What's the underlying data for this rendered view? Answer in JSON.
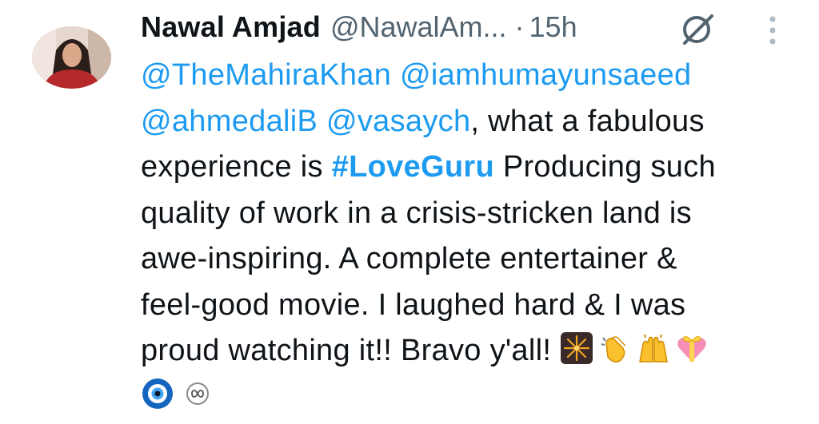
{
  "tweet": {
    "author_name": "Nawal Amjad",
    "author_handle": "@NawalAm...",
    "separator": "·",
    "timestamp": "15h",
    "icons": {
      "grok": "grok-slash-icon",
      "more": "more-vertical-icon"
    },
    "body": {
      "line1": {
        "mention1": "@TheMahiraKhan",
        "mention2": "@iamhumayunsaeed"
      },
      "line2": {
        "mention3": "@ahmedaliB",
        "mention4": "@vasaych",
        "text": ", what a fabulous"
      },
      "line3": {
        "text1": "experience is ",
        "hashtag": "#LoveGuru",
        "text2": " Producing such"
      },
      "line4": "quality of work in a crisis-stricken land is",
      "line5": "awe-inspiring. A complete entertainer &",
      "line6": "feel-good movie. I laughed hard & I was",
      "line7": "proud watching it!! Bravo y'all! "
    },
    "emojis": [
      "fireworks-emoji",
      "clapping-hands-emoji",
      "raising-hands-emoji",
      "heart-with-ribbon-emoji",
      "nazar-amulet-emoji"
    ],
    "colors": {
      "text": "#0f1419",
      "secondary": "#536471",
      "link": "#1d9bf0"
    }
  }
}
